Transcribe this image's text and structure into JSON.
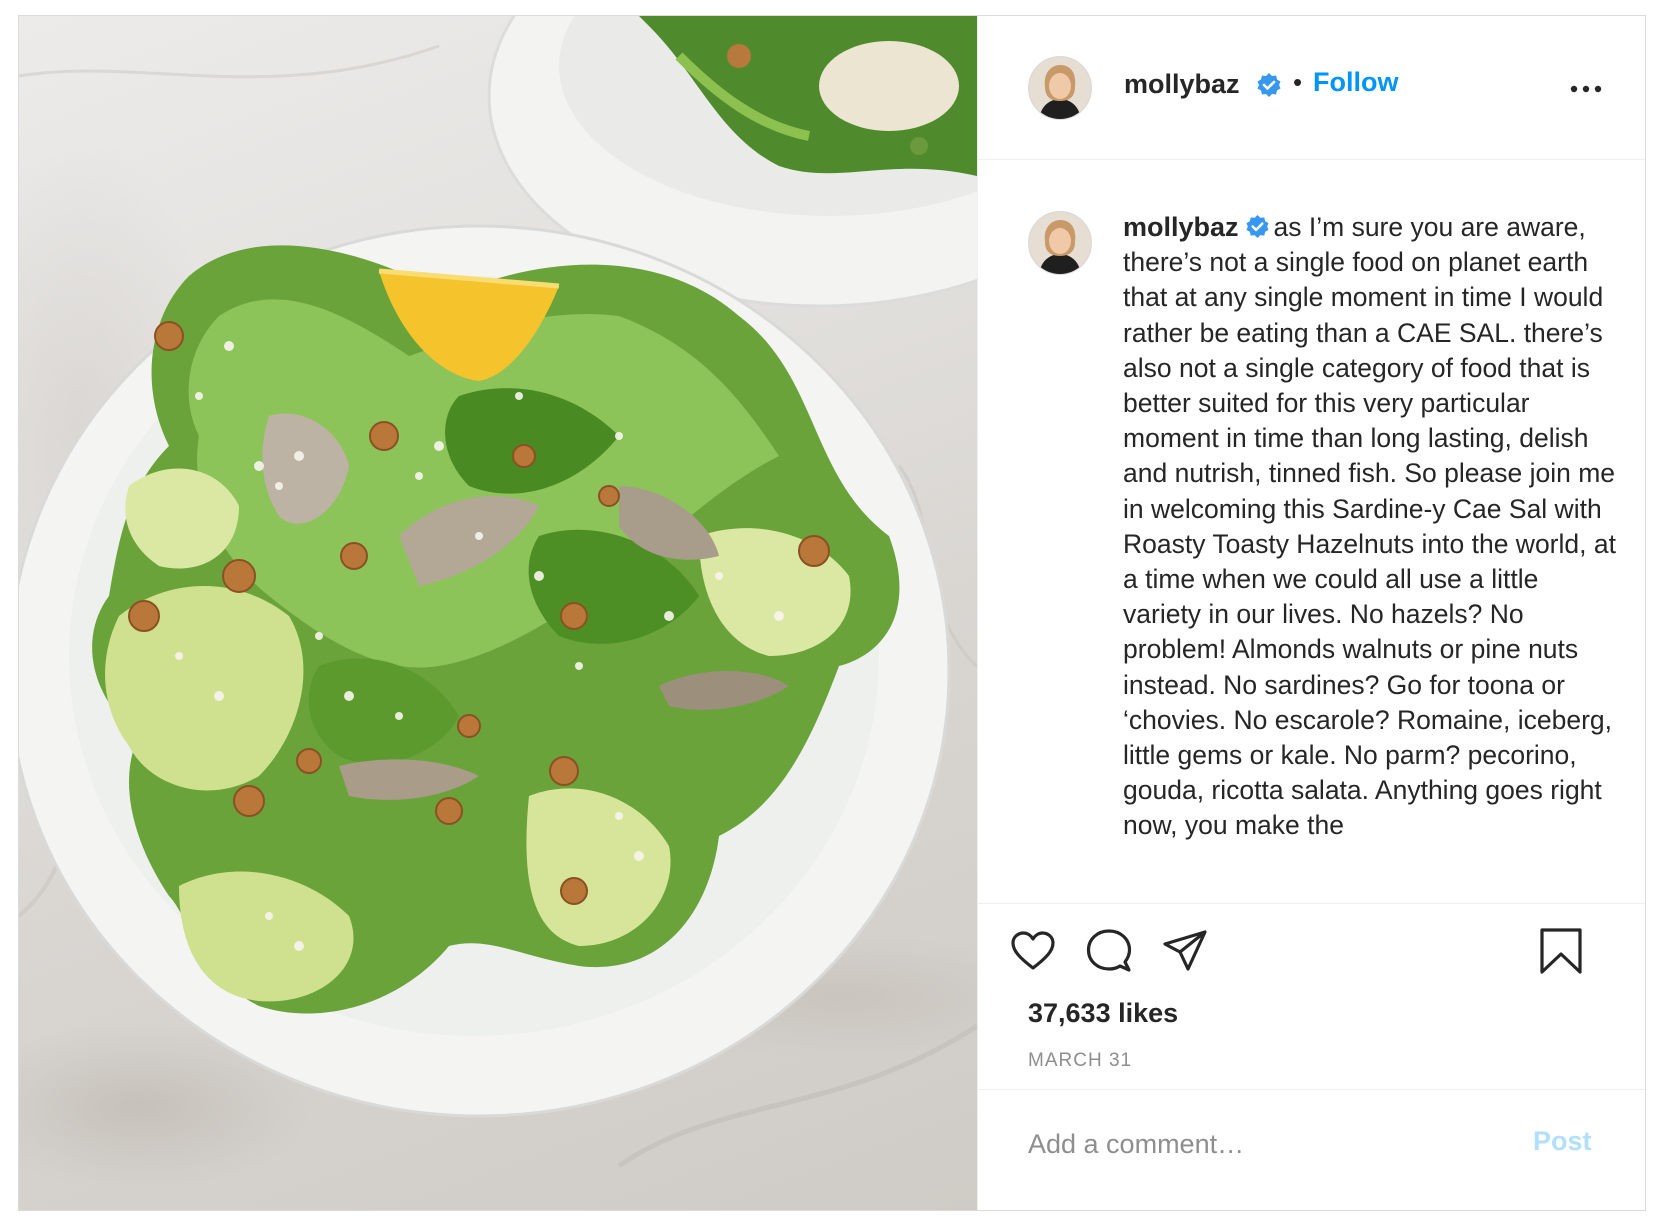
{
  "post": {
    "image_alt_name": "caesar salad photo"
  },
  "header": {
    "username": "mollybaz",
    "separator": "•",
    "follow_label": "Follow",
    "more_icon": "more-horizontal-icon",
    "verified_icon": "verified-badge-icon"
  },
  "caption": {
    "username": "mollybaz",
    "text": "as I’m sure you are aware, there’s not a single food on planet earth that at any single moment in time I would rather be eating than a CAE SAL. there’s also not a single category of food that is better suited for this very particular moment in time than long lasting, delish and nutrish, tinned fish. So please join me in welcoming this Sardine-y Cae Sal with Roasty Toasty Hazelnuts into the world, at a time when we could all use a little variety in our lives. No hazels? No problem! Almonds walnuts or pine nuts instead. No sardines? Go for toona or ‘chovies. No escarole? Romaine, iceberg, little gems or kale. No parm? pecorino, gouda, ricotta salata. Anything goes right now, you make the"
  },
  "actions": {
    "like_icon": "heart-icon",
    "comment_icon": "comment-bubble-icon",
    "share_icon": "paper-plane-icon",
    "save_icon": "bookmark-icon"
  },
  "likes": "37,633 likes",
  "date": "MARCH 31",
  "comment_box": {
    "placeholder": "Add a comment…",
    "post_label": "Post"
  },
  "colors": {
    "link_blue": "#0095f6",
    "post_disabled": "#b2dffc",
    "muted_text": "#8e8e8e",
    "border": "#dbdbdb"
  }
}
